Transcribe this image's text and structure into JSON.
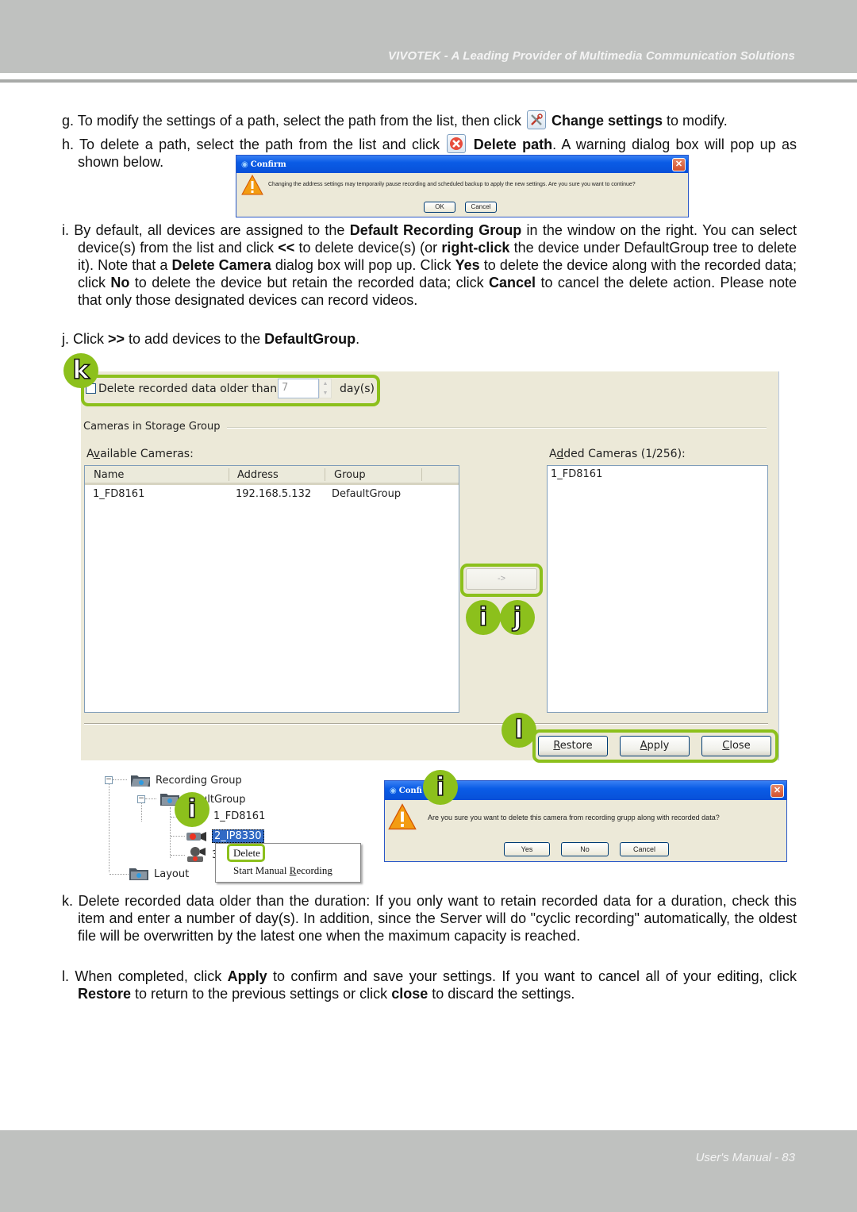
{
  "header": {
    "title": "VIVOTEK - A Leading Provider of Multimedia Communication Solutions"
  },
  "footer": {
    "page_label": "User's Manual - 83"
  },
  "steps": {
    "g": {
      "prefix": "g. To modify the settings of a path, select the path from the list, then click ",
      "icon": "wrench-screwdriver-icon",
      "bold": "Change settings",
      "suffix": " to modify."
    },
    "h": {
      "prefix": "h. To delete a path, select the path from the list and click ",
      "icon": "delete-x-icon",
      "bold": "Delete path",
      "suffix": ". A warning dialog box will pop up  as shown below."
    },
    "i": {
      "t1": "i. By default, all devices are assigned to the ",
      "b1": "Default Recording Group",
      "t2": " in the window on the right. You can select device(s) from the list and click ",
      "b2": "<<",
      "t3": " to delete device(s) (or ",
      "b3": "right-click",
      "t4": " the device under DefaultGroup tree to delete it). Note that a ",
      "b4": "Delete Camera",
      "t5": " dialog box will pop up. Click ",
      "b5": "Yes",
      "t6": " to delete the device along with the recorded data; click ",
      "b6": "No",
      "t7": " to delete the device but retain the recorded data; click ",
      "b7": "Cancel",
      "t8": " to cancel the delete action. Please note that only those designated devices can record videos."
    },
    "j": {
      "t1": "j. Click ",
      "b1": ">>",
      "t2": " to add devices to the ",
      "b2": "DefaultGroup",
      "t3": "."
    },
    "k": {
      "text": "k. Delete recorded data older than the duration: If you only want to retain recorded data for a duration, check this item and enter a number of day(s). In addition, since the Server will do \"cyclic recording\" automatically, the oldest file will be overwritten by the latest one when the maximum capacity is reached."
    },
    "l": {
      "t1": "l. When completed, click ",
      "b1": "Apply",
      "t2": " to confirm and save your settings. If you want to cancel all of your editing, click ",
      "b2": "Restore",
      "t3": " to return to the previous settings or click ",
      "b3": "close",
      "t4": " to discard the settings."
    }
  },
  "confirm_dialog_path": {
    "title": "Confirm",
    "message": "Changing the address settings may temporarily pause recording and scheduled backup to apply the new settings. Are you sure you want to continue?",
    "buttons": [
      "OK",
      "Cancel"
    ]
  },
  "storage_panel": {
    "delete_older": {
      "label": "Delete recorded data older than",
      "checked": false,
      "days_value": "7",
      "unit": "day(s)"
    },
    "group_label": "Cameras in Storage Group",
    "available": {
      "label_pre": "A",
      "label_u": "v",
      "label_post": "ailable Cameras:",
      "columns": [
        "Name",
        "Address",
        "Group"
      ],
      "rows": [
        {
          "name": "1_FD8161",
          "address": "192.168.5.132",
          "group": "DefaultGroup"
        }
      ]
    },
    "added": {
      "label_pre": "A",
      "label_u": "d",
      "label_post": "ded Cameras  (1/256):",
      "items": [
        "1_FD8161"
      ]
    },
    "add_button": "->",
    "buttons": {
      "restore": {
        "u": "R",
        "rest": "estore"
      },
      "apply": {
        "u": "A",
        "rest": "pply"
      },
      "close": {
        "u": "C",
        "rest": "lose"
      }
    }
  },
  "tree": {
    "root": "Recording Group",
    "group": "DefaultGroup",
    "group_visible": "ultGroup",
    "cameras": [
      "1_FD8161",
      "2_IP8330",
      "3"
    ],
    "layout": "Layout",
    "context_menu": {
      "delete": "Delete",
      "start_pre": "Start Manual ",
      "start_u": "R",
      "start_post": "ecording"
    }
  },
  "confirm_dialog_delete": {
    "title": "Confirm",
    "title_visible": "Confi",
    "message": "Are you sure you want to delete this camera from recording grupp along with recorded data?",
    "buttons": [
      "Yes",
      "No",
      "Cancel"
    ]
  },
  "badges": {
    "k": "k",
    "i": "i",
    "j": "j",
    "l": "l"
  },
  "colors": {
    "highlight": "#8cc01c",
    "header_bg": "#bfc1bf",
    "xp_blue": "#0a5ce6",
    "dialog_bg": "#ece9d8"
  }
}
